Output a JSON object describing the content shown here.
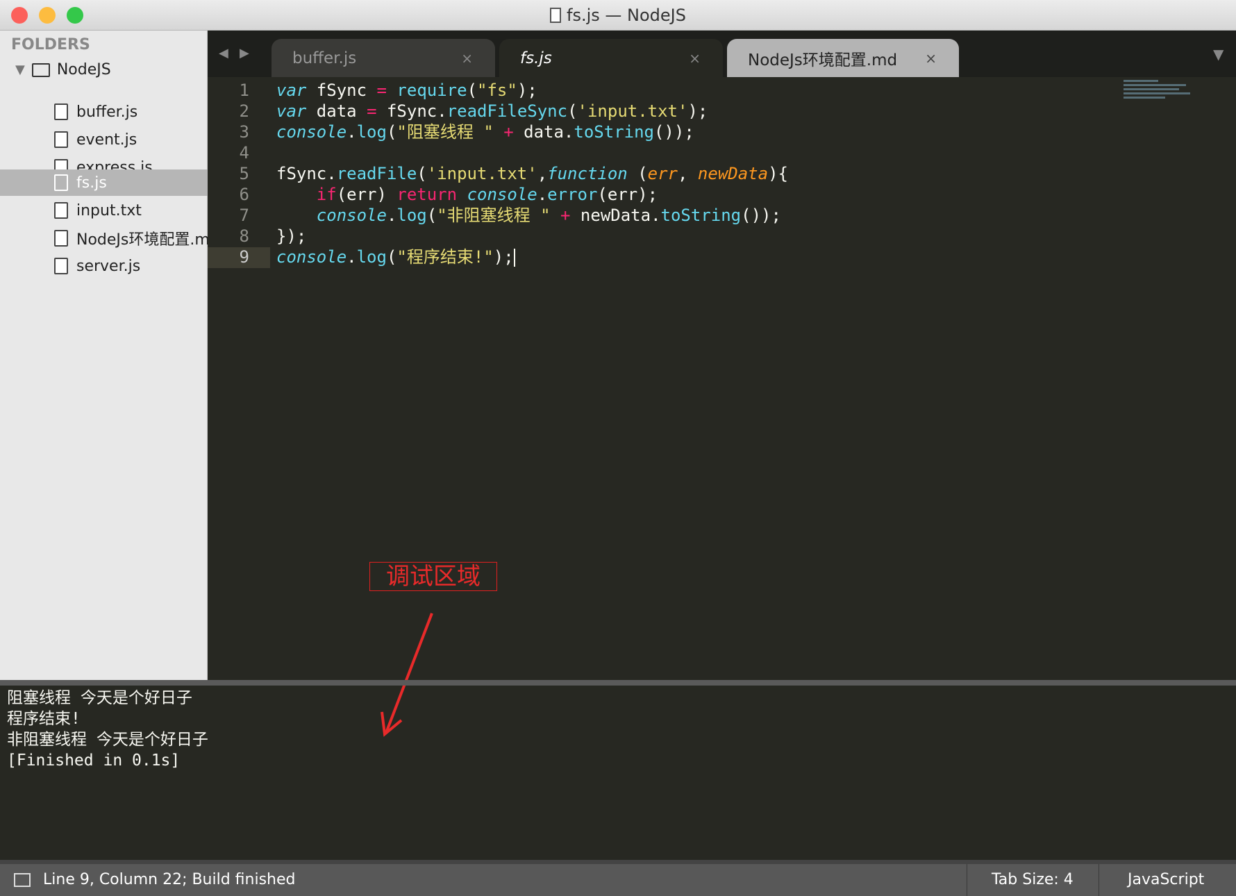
{
  "window": {
    "title": "fs.js — NodeJS"
  },
  "sidebar": {
    "header": "FOLDERS",
    "root": "NodeJS",
    "files": [
      {
        "name": "buffer.js"
      },
      {
        "name": "event.js"
      },
      {
        "name": "express.js"
      },
      {
        "name": "fs.js",
        "selected": true
      },
      {
        "name": "input.txt"
      },
      {
        "name": "NodeJs环境配置.md"
      },
      {
        "name": "server.js"
      }
    ]
  },
  "tabs": [
    {
      "label": "buffer.js",
      "close": "×"
    },
    {
      "label": "fs.js",
      "close": "×",
      "active": true
    },
    {
      "label": "NodeJs环境配置.md",
      "close": "×"
    }
  ],
  "code": {
    "line_numbers": [
      "1",
      "2",
      "3",
      "4",
      "5",
      "6",
      "7",
      "8",
      "9"
    ]
  },
  "annotation": {
    "label": "调试区域",
    "color": "#e82a2a"
  },
  "console": {
    "lines": [
      "阻塞线程 今天是个好日子",
      "程序结束!",
      "非阻塞线程 今天是个好日子",
      "[Finished in 0.1s]"
    ]
  },
  "statusbar": {
    "position": "Line 9, Column 22; Build finished",
    "tab_size": "Tab Size: 4",
    "syntax": "JavaScript"
  }
}
